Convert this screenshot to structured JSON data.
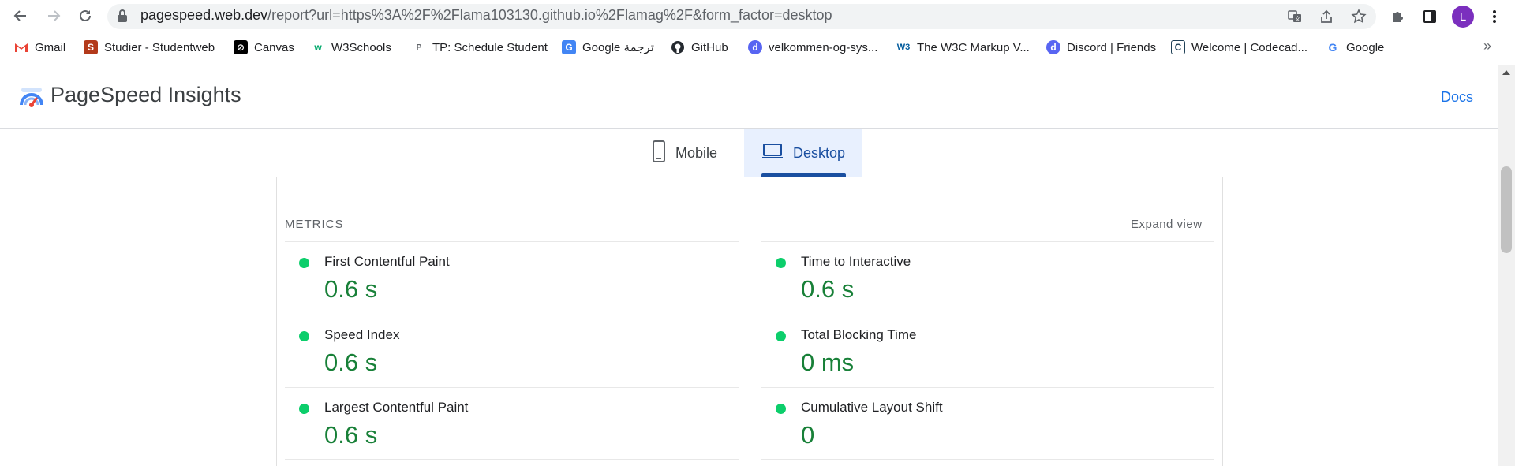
{
  "browser": {
    "url_host": "pagespeed.web.dev",
    "url_rest": "/report?url=https%3A%2F%2Flama103130.github.io%2Flamag%2F&form_factor=desktop",
    "avatar_letter": "L",
    "icons": [
      "back-icon",
      "forward-icon",
      "reload-icon",
      "lock-icon",
      "translate-icon",
      "share-icon",
      "star-icon",
      "extensions-icon",
      "side-panel-icon",
      "menu-icon"
    ]
  },
  "bookmarks": [
    {
      "label": "Gmail",
      "icon": "gmail-icon",
      "color": "#ea4335"
    },
    {
      "label": "Studier - Studentweb",
      "icon": "studentweb-icon",
      "color": "#b33a1b"
    },
    {
      "label": "Canvas",
      "icon": "canvas-icon",
      "color": "#000000"
    },
    {
      "label": "W3Schools",
      "icon": "w3schools-icon",
      "color": "#04aa6d"
    },
    {
      "label": "TP: Schedule Student",
      "icon": "tp-icon",
      "color": "#5f6368"
    },
    {
      "label": "Google ترجمة",
      "icon": "google-translate-icon",
      "color": "#4285f4"
    },
    {
      "label": "GitHub",
      "icon": "github-icon",
      "color": "#24292f"
    },
    {
      "label": "velkommen-og-sys...",
      "icon": "discord-icon",
      "color": "#5865f2"
    },
    {
      "label": "The W3C Markup V...",
      "icon": "w3c-icon",
      "color": "#005a9c"
    },
    {
      "label": "Discord | Friends",
      "icon": "discord-icon",
      "color": "#5865f2"
    },
    {
      "label": "Welcome | Codecad...",
      "icon": "codecademy-icon",
      "color": "#1f4056"
    },
    {
      "label": "Google",
      "icon": "google-icon",
      "color": "#4285f4"
    }
  ],
  "bookmarks_more": "»",
  "header": {
    "title": "PageSpeed Insights",
    "docs_link": "Docs"
  },
  "tabs": [
    {
      "label": "Mobile",
      "icon": "mobile-icon",
      "selected": false
    },
    {
      "label": "Desktop",
      "icon": "desktop-icon",
      "selected": true
    }
  ],
  "metrics": {
    "section_title": "METRICS",
    "expand_label": "Expand view",
    "status_color": "#0cce6b",
    "value_color": "#188038",
    "items": [
      {
        "label": "First Contentful Paint",
        "value": "0.6 s"
      },
      {
        "label": "Time to Interactive",
        "value": "0.6 s"
      },
      {
        "label": "Speed Index",
        "value": "0.6 s"
      },
      {
        "label": "Total Blocking Time",
        "value": "0 ms"
      },
      {
        "label": "Largest Contentful Paint",
        "value": "0.6 s"
      },
      {
        "label": "Cumulative Layout Shift",
        "value": "0"
      }
    ]
  }
}
